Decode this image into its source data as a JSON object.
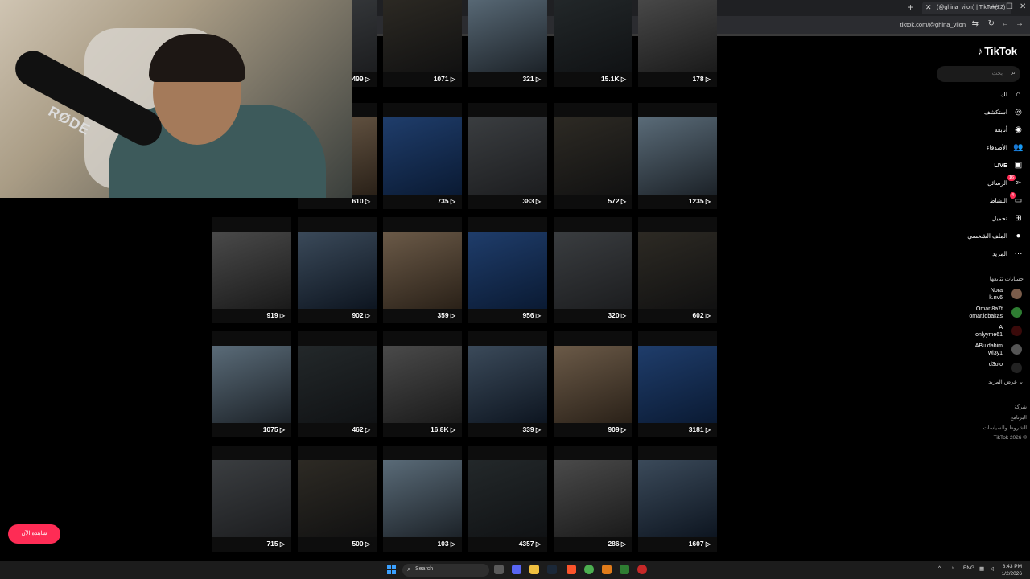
{
  "browser": {
    "new_tab": "+",
    "tab_title": "(@ghina_vilon) | TikTok(22)",
    "url": "tiktok.com/@ghina_vilon",
    "min": "—",
    "max": "☐",
    "close": "✕"
  },
  "grid": {
    "rows": [
      {
        "top": 0,
        "cells": [
          {
            "views": "499",
            "col": 0
          },
          {
            "views": "1071",
            "col": 1
          },
          {
            "views": "321",
            "col": 2
          },
          {
            "views": "15.1K",
            "col": 3
          },
          {
            "views": "178",
            "col": 4
          }
        ]
      },
      {
        "cells": [
          {
            "views": "610"
          },
          {
            "views": "735"
          },
          {
            "views": "383"
          },
          {
            "views": "572"
          },
          {
            "views": "1235"
          }
        ]
      },
      {
        "cells": [
          {
            "views": "919"
          },
          {
            "views": "902"
          },
          {
            "views": "359"
          },
          {
            "views": "956"
          },
          {
            "views": "320"
          },
          {
            "views": "602"
          }
        ]
      },
      {
        "cells": [
          {
            "views": "1075"
          },
          {
            "views": "462"
          },
          {
            "views": "16.8K"
          },
          {
            "views": "339"
          },
          {
            "views": "909"
          },
          {
            "views": "3181"
          }
        ]
      },
      {
        "cells": [
          {
            "views": "715"
          },
          {
            "views": "500"
          },
          {
            "views": "103"
          },
          {
            "views": "4357"
          },
          {
            "views": "286"
          },
          {
            "views": "1607"
          }
        ]
      }
    ]
  },
  "sidebar": {
    "logo": "TikTok",
    "search_placeholder": "بحث",
    "nav": [
      {
        "label": "لك",
        "icon": "home-icon",
        "glyph": "⌂"
      },
      {
        "label": "استكشف",
        "icon": "compass-icon",
        "glyph": "◎"
      },
      {
        "label": "أتابعه",
        "icon": "following-icon",
        "glyph": "◉"
      },
      {
        "label": "الأصدقاء",
        "icon": "friends-icon",
        "glyph": "👥"
      },
      {
        "label": "LIVE",
        "icon": "live-icon",
        "glyph": "▣"
      },
      {
        "label": "الرسائل",
        "icon": "messages-icon",
        "glyph": "➢",
        "badge": "16"
      },
      {
        "label": "النشاط",
        "icon": "activity-icon",
        "glyph": "▭",
        "badge": "4"
      },
      {
        "label": "تحميل",
        "icon": "upload-icon",
        "glyph": "⊞"
      },
      {
        "label": "الملف الشخصي",
        "icon": "profile-icon",
        "glyph": "●"
      },
      {
        "label": "المزيد",
        "icon": "more-icon",
        "glyph": "···"
      }
    ],
    "following_title": "حسابات تتابعها",
    "accounts": [
      {
        "name": "Nora",
        "handle": "k.nv6"
      },
      {
        "name": "Omar 8a7t",
        "handle": "omar.idbakas"
      },
      {
        "name": "A",
        "handle": "onlyyme61"
      },
      {
        "name": "ABu dahim",
        "handle": "wi3y1"
      },
      {
        "name": "",
        "handle": "d3olo"
      }
    ],
    "see_more": "عرض المزيد",
    "footer": [
      "شركة",
      "البرنامج",
      "الشروط والسياسات",
      "TikTok 2026 ©"
    ]
  },
  "float_button": "شاهده الآن",
  "taskbar": {
    "search": "Search",
    "lang": "ENG",
    "time": "8:43 PM",
    "date": "1/2/2026"
  },
  "webcam": {
    "mic_brand": "RØDE"
  }
}
